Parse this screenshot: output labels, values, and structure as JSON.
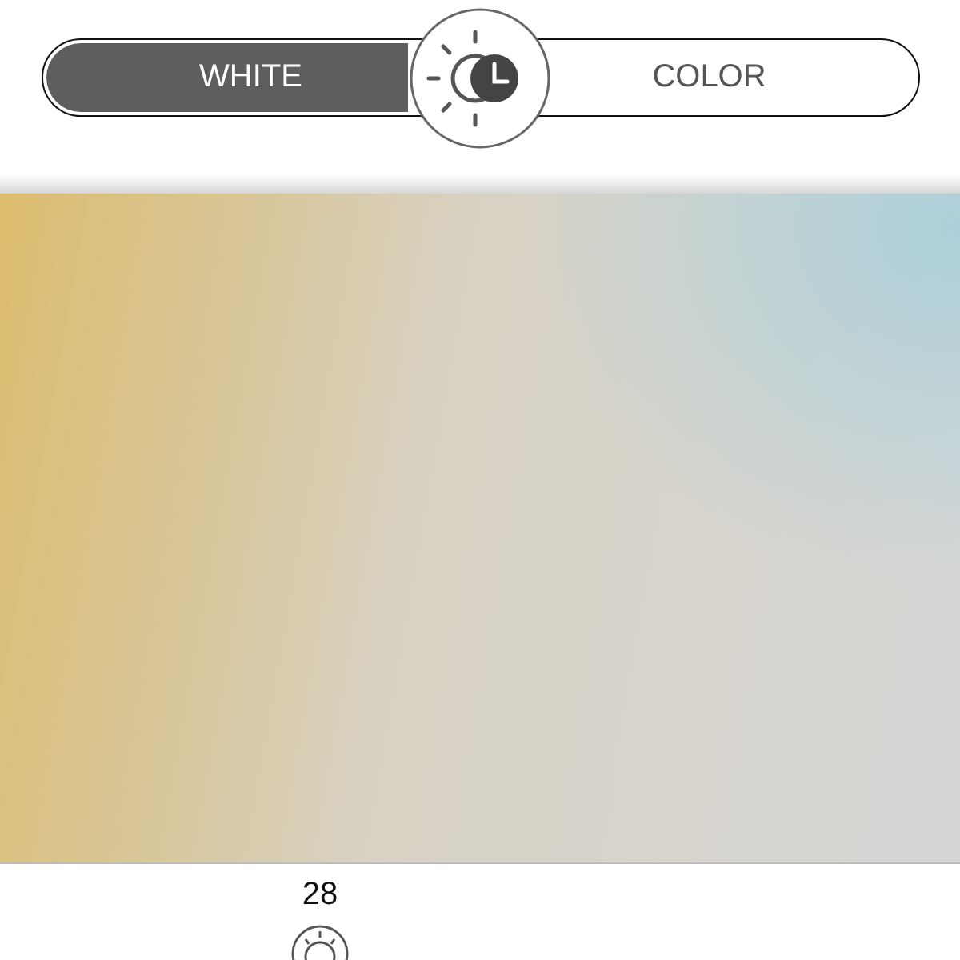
{
  "mode_toggle": {
    "options": [
      {
        "label": "WHITE",
        "selected": true
      },
      {
        "label": "COLOR",
        "selected": false
      }
    ]
  },
  "temperature_value": "28"
}
